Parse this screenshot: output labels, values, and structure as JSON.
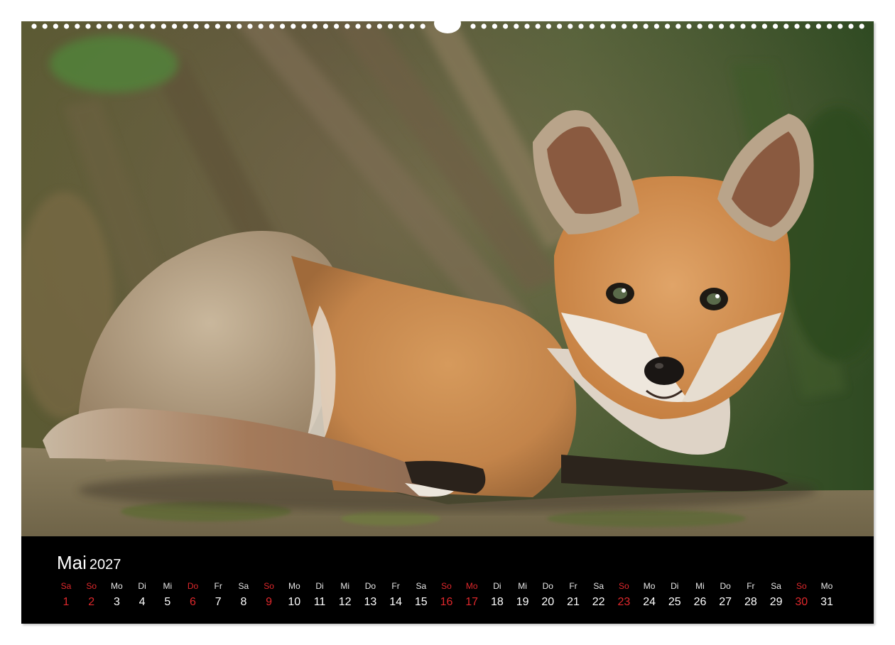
{
  "calendar": {
    "month": "Mai",
    "year": "2027",
    "days": [
      {
        "wd": "Sa",
        "d": "1",
        "red": true
      },
      {
        "wd": "So",
        "d": "2",
        "red": true
      },
      {
        "wd": "Mo",
        "d": "3",
        "red": false
      },
      {
        "wd": "Di",
        "d": "4",
        "red": false
      },
      {
        "wd": "Mi",
        "d": "5",
        "red": false
      },
      {
        "wd": "Do",
        "d": "6",
        "red": true
      },
      {
        "wd": "Fr",
        "d": "7",
        "red": false
      },
      {
        "wd": "Sa",
        "d": "8",
        "red": false
      },
      {
        "wd": "So",
        "d": "9",
        "red": true
      },
      {
        "wd": "Mo",
        "d": "10",
        "red": false
      },
      {
        "wd": "Di",
        "d": "11",
        "red": false
      },
      {
        "wd": "Mi",
        "d": "12",
        "red": false
      },
      {
        "wd": "Do",
        "d": "13",
        "red": false
      },
      {
        "wd": "Fr",
        "d": "14",
        "red": false
      },
      {
        "wd": "Sa",
        "d": "15",
        "red": false
      },
      {
        "wd": "So",
        "d": "16",
        "red": true
      },
      {
        "wd": "Mo",
        "d": "17",
        "red": true
      },
      {
        "wd": "Di",
        "d": "18",
        "red": false
      },
      {
        "wd": "Mi",
        "d": "19",
        "red": false
      },
      {
        "wd": "Do",
        "d": "20",
        "red": false
      },
      {
        "wd": "Fr",
        "d": "21",
        "red": false
      },
      {
        "wd": "Sa",
        "d": "22",
        "red": false
      },
      {
        "wd": "So",
        "d": "23",
        "red": true
      },
      {
        "wd": "Mo",
        "d": "24",
        "red": false
      },
      {
        "wd": "Di",
        "d": "25",
        "red": false
      },
      {
        "wd": "Mi",
        "d": "26",
        "red": false
      },
      {
        "wd": "Do",
        "d": "27",
        "red": false
      },
      {
        "wd": "Fr",
        "d": "28",
        "red": false
      },
      {
        "wd": "Sa",
        "d": "29",
        "red": false
      },
      {
        "wd": "So",
        "d": "30",
        "red": true
      },
      {
        "wd": "Mo",
        "d": "31",
        "red": false
      }
    ]
  },
  "colors": {
    "holiday": "#e0282c",
    "text": "#ffffff",
    "band": "#000000"
  },
  "photo": {
    "subject": "fox-cub-photo"
  }
}
